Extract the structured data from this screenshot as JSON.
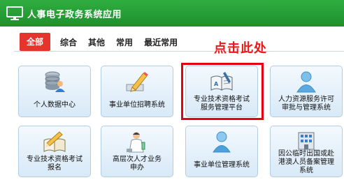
{
  "header": {
    "title": "人事电子政务系统应用",
    "icon": "monitor-icon"
  },
  "tabs": [
    {
      "label": "全部",
      "active": true
    },
    {
      "label": "综合",
      "active": false
    },
    {
      "label": "其他",
      "active": false
    },
    {
      "label": "常用",
      "active": false
    },
    {
      "label": "最近常用",
      "active": false
    }
  ],
  "annotation": "点击此处",
  "apps": [
    {
      "lines": [
        "个人数据中心"
      ],
      "icon": "database-user-icon"
    },
    {
      "lines": [
        "事业单位招聘系统"
      ],
      "icon": "pencil-icon"
    },
    {
      "lines": [
        "专业技术资格考试",
        "服务管理平台"
      ],
      "icon": "open-book-icon"
    },
    {
      "lines": [
        "人力资源服务许可",
        "审批与管理系统"
      ],
      "icon": "person-icon"
    },
    {
      "lines": [
        "专业技术资格考试",
        "报名"
      ],
      "icon": "book-pencil-icon"
    },
    {
      "lines": [
        "高层次人才业务",
        "申办"
      ],
      "icon": "scientist-icon"
    },
    {
      "lines": [
        "事业单位管理系统"
      ],
      "icon": "user-icon"
    },
    {
      "lines": [
        "因公临时出国或赴",
        "港澳人员备案管理",
        "系统"
      ],
      "icon": "building-icon"
    }
  ],
  "colors": {
    "header": "#2fae3f",
    "tab_active": "#e4342c",
    "annotation": "#f01616",
    "highlight": "#e60012",
    "card_border": "#b3cde3"
  }
}
